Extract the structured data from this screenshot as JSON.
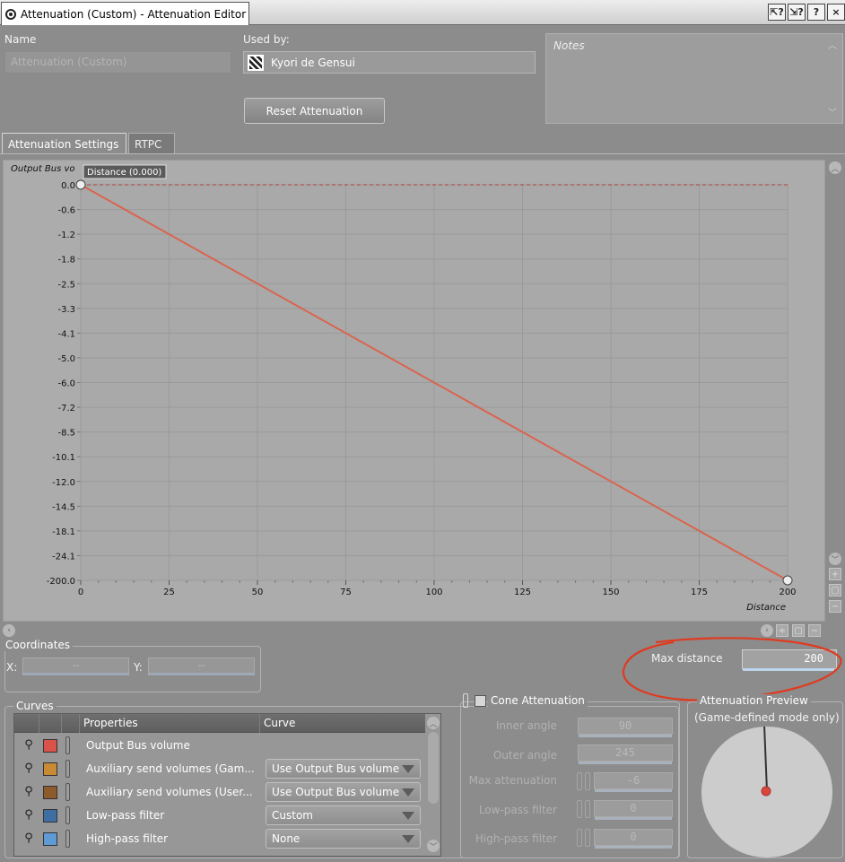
{
  "window": {
    "title": "Attenuation (Custom) - Attenuation Editor",
    "buttons": [
      "⇱?",
      "⇲?",
      "?",
      "×"
    ]
  },
  "general": {
    "name_label": "Name",
    "name_value": "Attenuation (Custom)",
    "used_by_label": "Used by:",
    "used_by_value": "Kyori de Gensui",
    "reset_button": "Reset Attenuation",
    "notes_placeholder": "Notes"
  },
  "tabs": [
    {
      "label": "Attenuation Settings",
      "active": true
    },
    {
      "label": "RTPC",
      "active": false
    }
  ],
  "graph": {
    "y_axis_title": "Output Bus vo",
    "tooltip": "Distance (0.000)",
    "y_ticks": [
      "0.0",
      "-0.6",
      "-1.2",
      "-1.8",
      "-2.5",
      "-3.3",
      "-4.1",
      "-5.0",
      "-6.0",
      "-7.2",
      "-8.5",
      "-10.1",
      "-12.0",
      "-14.5",
      "-18.1",
      "-24.1",
      "-200.0"
    ],
    "x_ticks": [
      "0",
      "25",
      "50",
      "75",
      "100",
      "125",
      "150",
      "175",
      "200"
    ],
    "x_axis_title": "Distance",
    "curve_color": "#d9654f",
    "points": [
      {
        "distance": 0,
        "volume": "0.0"
      },
      {
        "distance": 200,
        "volume": "-200.0"
      }
    ]
  },
  "coordinates": {
    "title": "Coordinates",
    "x_label": "X:",
    "x_value": "--",
    "y_label": "Y:",
    "y_value": "--"
  },
  "max_distance": {
    "label": "Max distance",
    "value": "200",
    "annotation_color": "#e03a20"
  },
  "curves": {
    "title": "Curves",
    "headers": {
      "properties": "Properties",
      "curve": "Curve"
    },
    "rows": [
      {
        "name": "Output Bus volume",
        "color": "#d9534a",
        "curve": ""
      },
      {
        "name": "Auxiliary send volumes (Gam...",
        "color": "#c98a36",
        "curve": "Use Output Bus volume"
      },
      {
        "name": "Auxiliary send volumes (User...",
        "color": "#8d5a2c",
        "curve": "Use Output Bus volume"
      },
      {
        "name": "Low-pass filter",
        "color": "#3f6ea3",
        "curve": "Custom"
      },
      {
        "name": "High-pass filter",
        "color": "#5e9bd4",
        "curve": "None"
      }
    ]
  },
  "cone": {
    "title": "Cone Attenuation",
    "inner_angle_label": "Inner angle",
    "inner_angle_value": "90",
    "outer_angle_label": "Outer angle",
    "outer_angle_value": "245",
    "max_attenuation_label": "Max attenuation",
    "max_attenuation_value": "-6",
    "low_pass_label": "Low-pass filter",
    "low_pass_value": "0",
    "high_pass_label": "High-pass filter",
    "high_pass_value": "0"
  },
  "preview": {
    "title": "Attenuation Preview",
    "subtitle": "(Game-defined mode only)"
  }
}
